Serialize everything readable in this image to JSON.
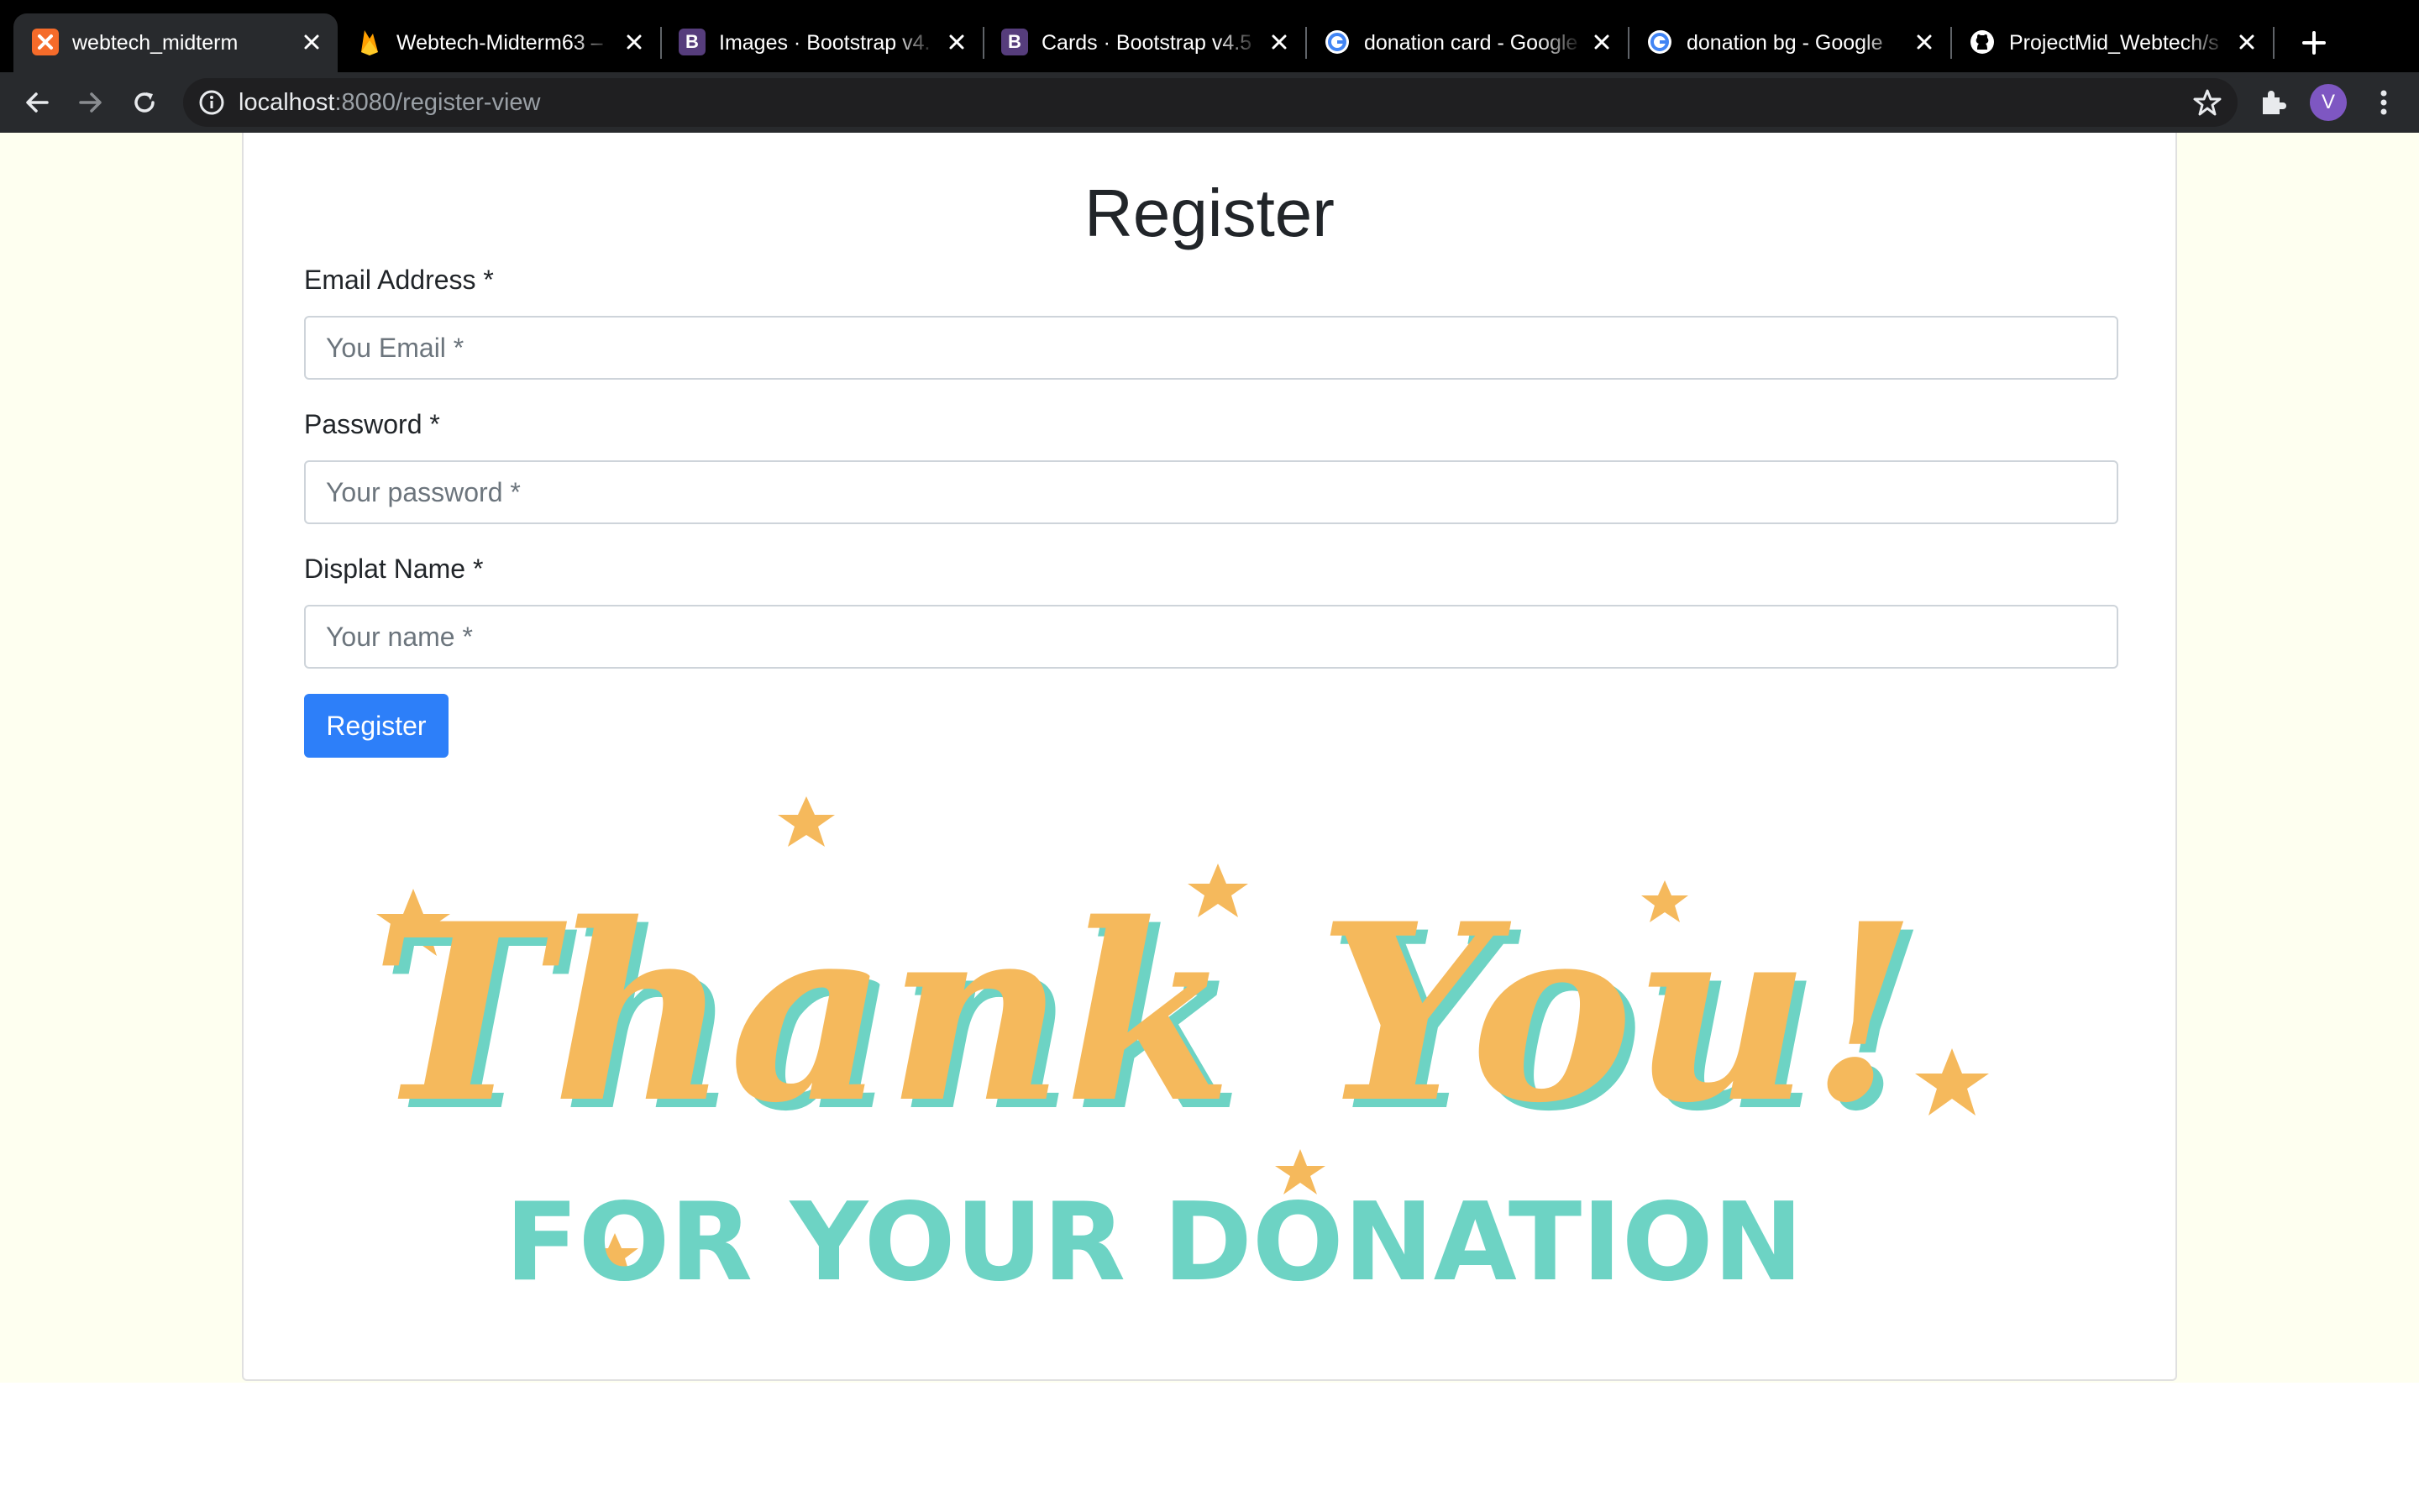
{
  "browser": {
    "tabs": [
      {
        "title": "webtech_midterm",
        "favicon": "xampp-icon",
        "color": "#f56b2a",
        "active": true
      },
      {
        "title": "Webtech-Midterm63 –",
        "favicon": "firebase-icon",
        "color": "#ffa000",
        "active": false
      },
      {
        "title": "Images · Bootstrap v4.",
        "favicon": "bootstrap-icon",
        "color": "#563d7c",
        "active": false
      },
      {
        "title": "Cards · Bootstrap v4.5",
        "favicon": "bootstrap-icon",
        "color": "#563d7c",
        "active": false
      },
      {
        "title": "donation card - Google",
        "favicon": "google-icon",
        "color": "#ffffff",
        "active": false
      },
      {
        "title": "donation bg - Google",
        "favicon": "google-icon",
        "color": "#ffffff",
        "active": false
      },
      {
        "title": "ProjectMid_Webtech/s",
        "favicon": "github-icon",
        "color": "#ffffff",
        "active": false
      }
    ],
    "url_host": "localhost",
    "url_rest": ":8080/register-view",
    "avatar_letter": "V"
  },
  "form": {
    "title": "Register",
    "email_label": "Email Address *",
    "email_placeholder": "You Email *",
    "password_label": "Password *",
    "password_placeholder": "Your password *",
    "name_label": "Displat Name *",
    "name_placeholder": "Your name *",
    "submit_label": "Register"
  },
  "thank_you_image": {
    "line1": "Thank You!",
    "line2": "FOR YOUR DONATION",
    "orange": "#f5b95c",
    "teal": "#6dd3c4"
  },
  "colors": {
    "page_background": "#fefff0",
    "primary_button": "#2d7ff9"
  }
}
